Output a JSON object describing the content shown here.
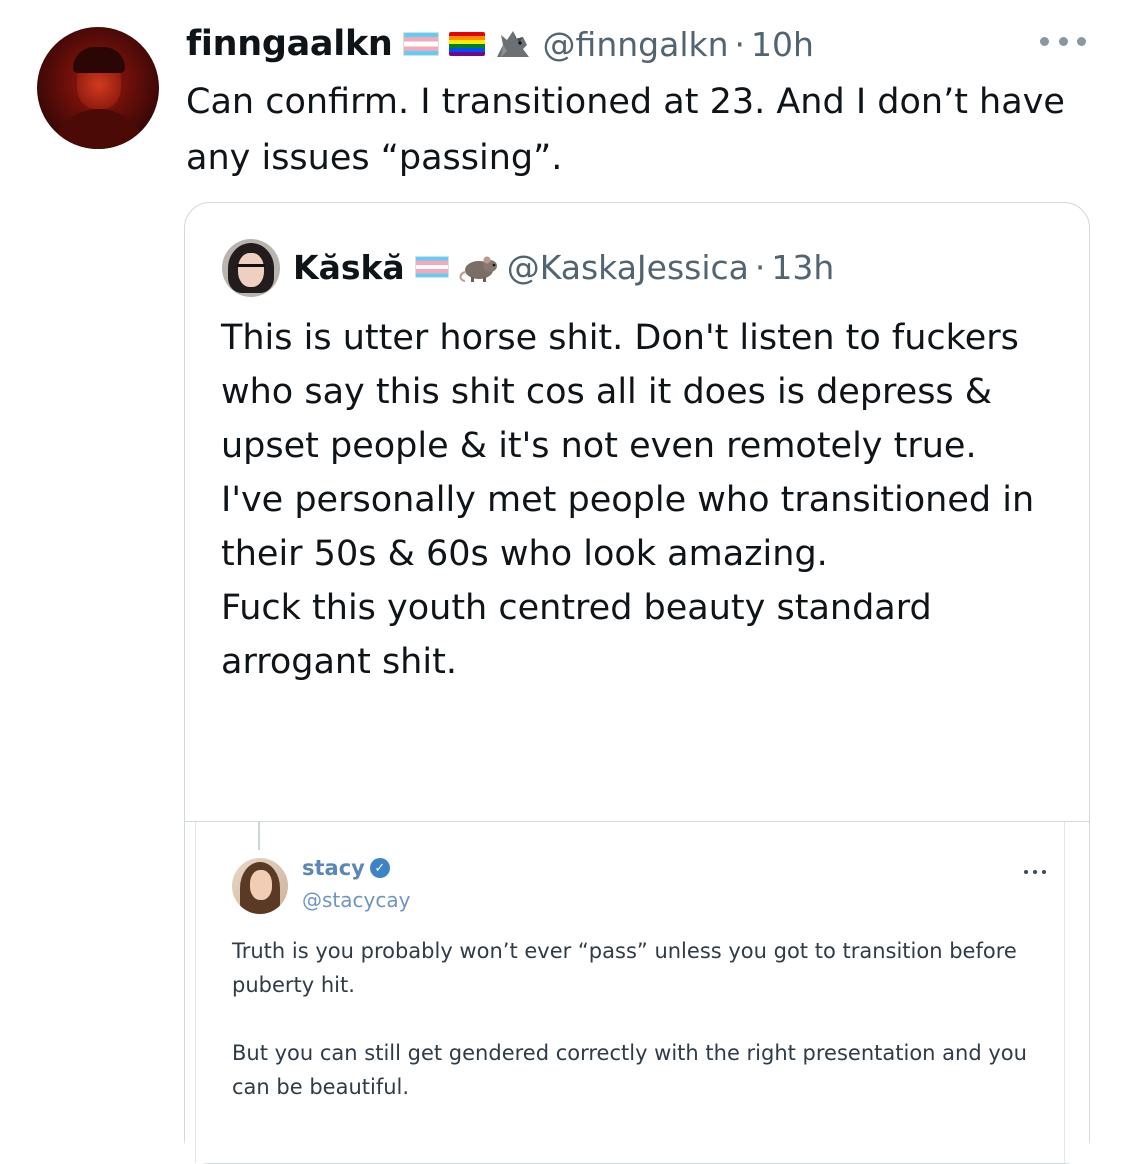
{
  "main_tweet": {
    "display_name": "finngaalkn",
    "handle": "@finngalkn",
    "separator": "·",
    "time": "10h",
    "text": "Can confirm. I transitioned at 23. And I don’t have any issues “passing”.",
    "icons": [
      "trans-flag-icon",
      "rainbow-flag-icon",
      "wolf-emoji-icon",
      "more-options-icon"
    ]
  },
  "quoted_tweet": {
    "display_name": "Kăskă",
    "handle": "@KaskaJessica",
    "separator": "·",
    "time": "13h",
    "text": "This is utter horse shit. Don't listen to fuckers who say this shit cos all it does is depress & upset people & it's not even remotely true.\nI've personally met people who transitioned in their 50s & 60s who look amazing.\nFuck this youth centred beauty standard arrogant shit.",
    "icons": [
      "trans-flag-icon",
      "rat-emoji-icon"
    ]
  },
  "embedded_screenshot": {
    "display_name": "stacy",
    "handle": "@stacycay",
    "verified_mark": "✓",
    "text": "Truth is you probably won’t ever “pass” unless you got to transition before puberty hit.\n\nBut you can still get gendered correctly with the right presentation and you can be beautiful."
  },
  "colors": {
    "text_primary": "#0f1419",
    "text_secondary": "#536471",
    "border": "#cfd9de",
    "link_blue": "#5b86b8"
  }
}
